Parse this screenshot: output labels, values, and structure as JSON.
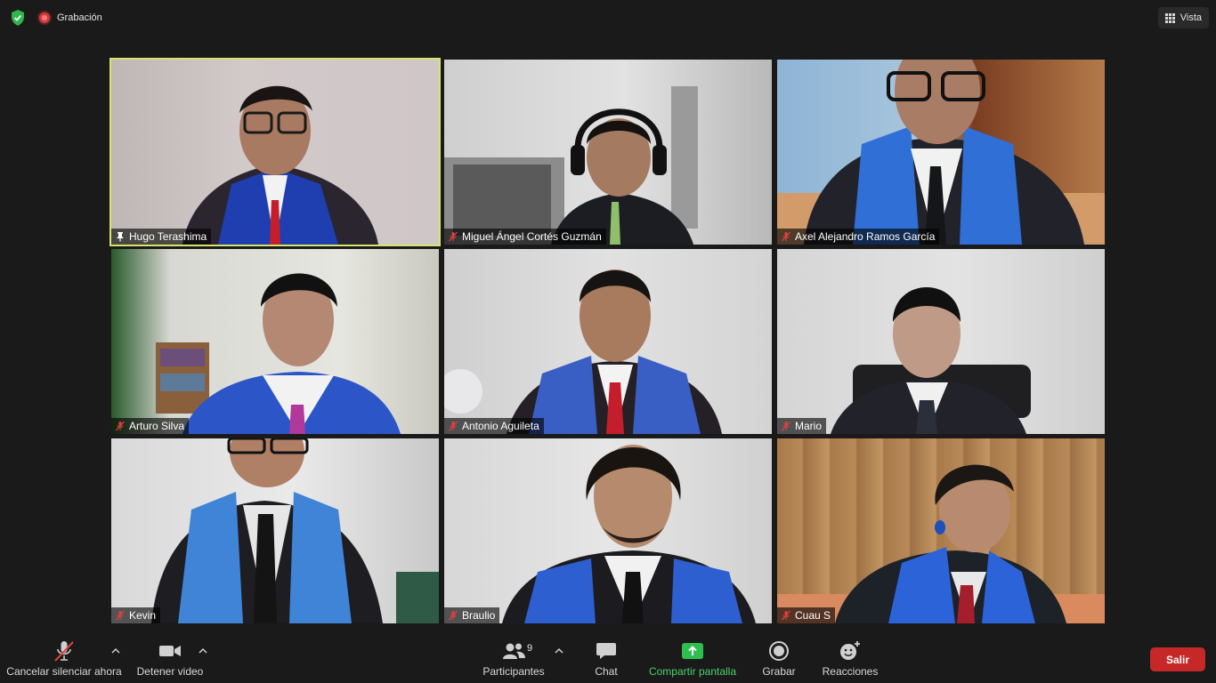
{
  "topbar": {
    "recording_label": "Grabación",
    "view_label": "Vista",
    "icons": {
      "security": "shield-check-icon",
      "recording": "record-dot-icon",
      "view": "grid-icon"
    }
  },
  "participants": [
    {
      "name": "Hugo Terashima",
      "status_icon": "pin-icon",
      "active_speaker": true
    },
    {
      "name": "Miguel Ángel Cortés Guzmán",
      "status_icon": "mic-muted-icon",
      "active_speaker": false
    },
    {
      "name": "Axel Alejandro Ramos García",
      "status_icon": "mic-muted-icon",
      "active_speaker": false
    },
    {
      "name": "Arturo Silva",
      "status_icon": "mic-muted-icon",
      "active_speaker": false
    },
    {
      "name": "Antonio Aguileta",
      "status_icon": "mic-muted-icon",
      "active_speaker": false
    },
    {
      "name": "Mario",
      "status_icon": "mic-muted-icon",
      "active_speaker": false
    },
    {
      "name": "Kevin",
      "status_icon": "mic-muted-icon",
      "active_speaker": false
    },
    {
      "name": "Braulio",
      "status_icon": "mic-muted-icon",
      "active_speaker": false
    },
    {
      "name": "Cuau S",
      "status_icon": "mic-muted-icon",
      "active_speaker": false
    }
  ],
  "toolbar": {
    "unmute_label": "Cancelar silenciar ahora",
    "video_label": "Detener video",
    "participants_label": "Participantes",
    "participants_count": "9",
    "chat_label": "Chat",
    "share_label": "Compartir pantalla",
    "record_label": "Grabar",
    "reactions_label": "Reacciones",
    "leave_label": "Salir"
  },
  "colors": {
    "active_speaker_border": "#d7e56a",
    "share_green": "#49d36b",
    "leave_red": "#c62828",
    "muted_red": "#e04040"
  }
}
